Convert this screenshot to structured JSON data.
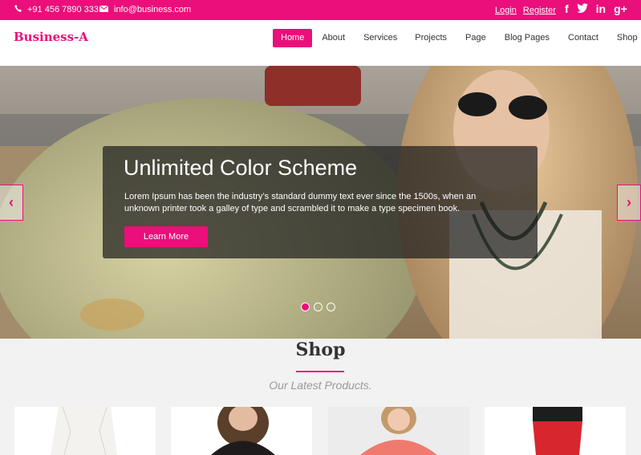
{
  "topbar": {
    "phone": "+91 456 7890 333",
    "email": "info@business.com",
    "login": "Login",
    "register": "Register",
    "social": [
      "f",
      "t",
      "in",
      "g+"
    ]
  },
  "header": {
    "logo": "Business-A",
    "nav": [
      "Home",
      "About",
      "Services",
      "Projects",
      "Page",
      "Blog Pages",
      "Contact",
      "Shop"
    ],
    "active": "Home"
  },
  "hero": {
    "title": "Unlimited Color Scheme",
    "text": "Lorem Ipsum has been the industry’s standard dummy text ever since the 1500s, when an unknown printer took a galley of type and scrambled it to make a type specimen book.",
    "button": "Learn More",
    "prev": "‹",
    "next": "›",
    "slides_total": 3,
    "slide_active": 1
  },
  "shop": {
    "title": "Shop",
    "subtitle": "Our Latest Products."
  },
  "colors": {
    "accent": "#ea0f7a"
  }
}
